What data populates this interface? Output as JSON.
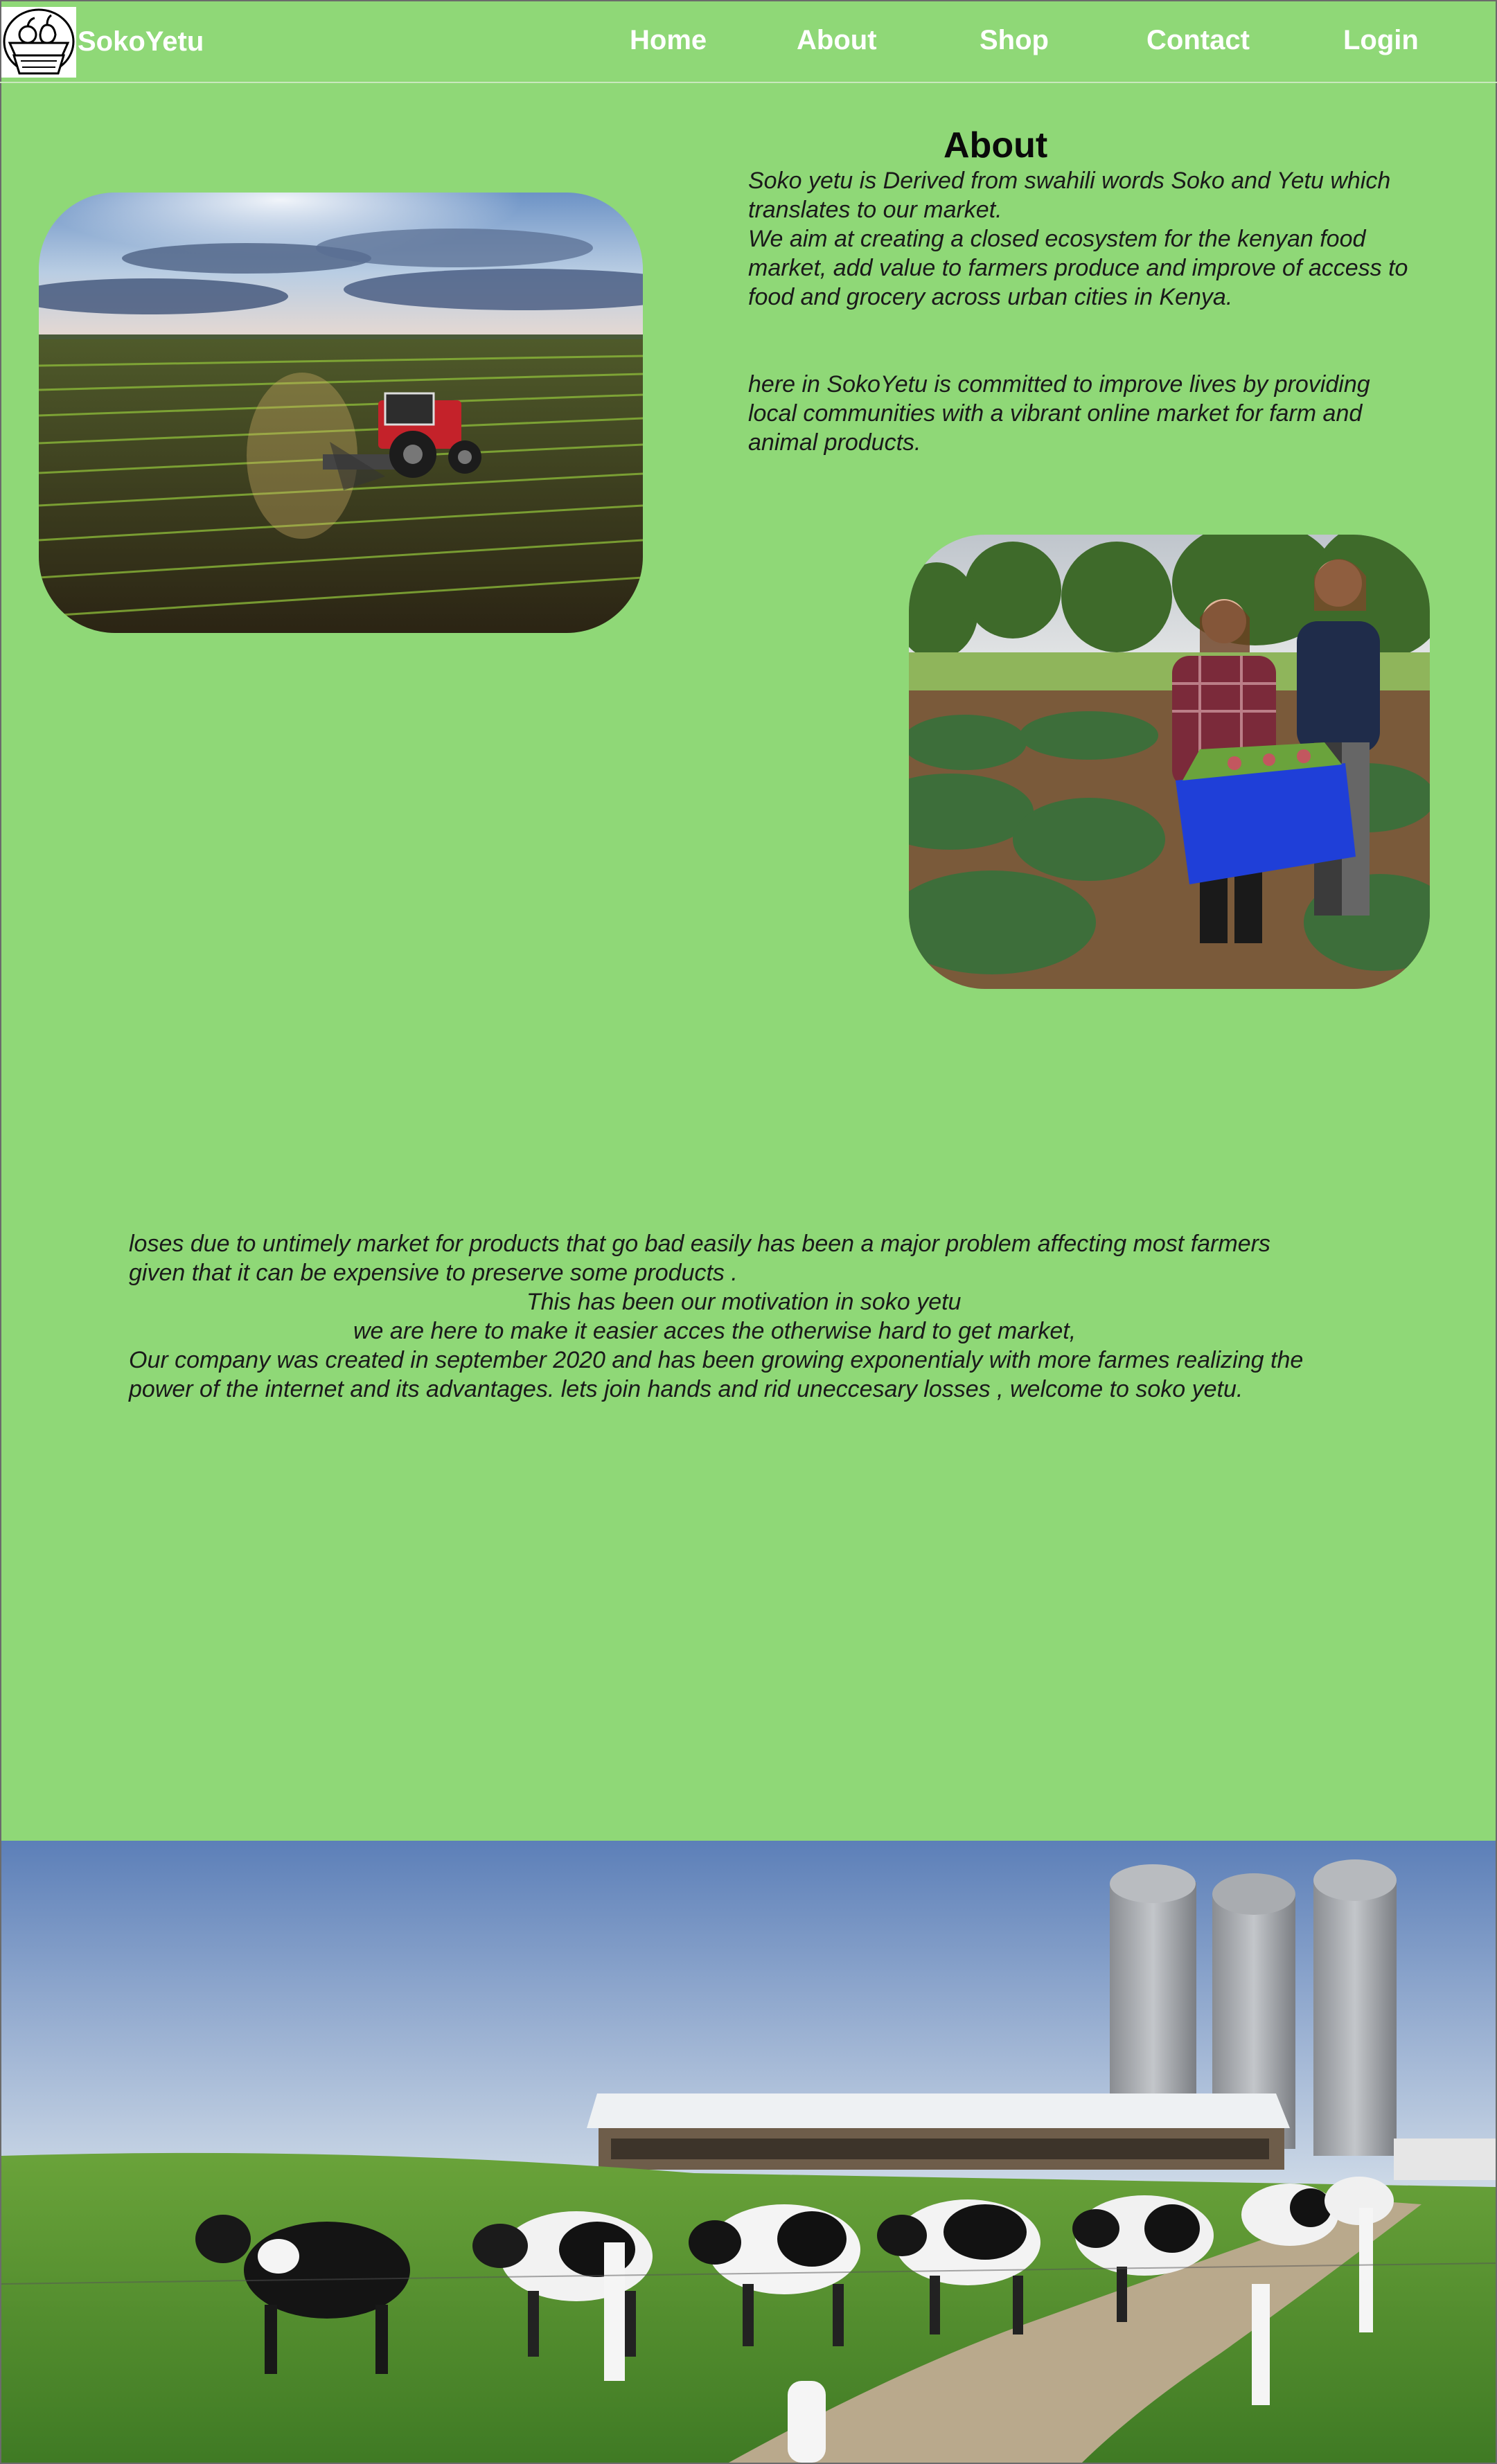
{
  "nav": {
    "brand": "SokoYetu",
    "links": [
      "Home",
      "About",
      "Shop",
      "Contact",
      "Login"
    ]
  },
  "about": {
    "title": "About",
    "para1_lines": [
      "Soko yetu is Derived from swahili words Soko and Yetu which",
      "translates to our market.",
      "We aim at creating a closed ecosystem for the kenyan food",
      "market, add value to farmers produce and improve of access to",
      "food and grocery across urban cities in Kenya."
    ],
    "para2_lines": [
      "here in SokoYetu is committed to improve lives by providing",
      "local communities with a vibrant online market for farm and",
      "animal  products."
    ]
  },
  "story": {
    "lines": [
      "loses due to untimely market for products that go bad easily has been a major problem affecting most farmers",
      "given that it can be expensive to preserve some products .",
      "This has been our motivation in soko yetu",
      "we are here to make it easier acces  the otherwise hard to get  market,",
      "Our company was created in september 2020 and has been growing exponentialy with more farmes realizing the",
      "power of the internet and its advantages. lets join hands and rid uneccesary losses , welcome to soko yetu."
    ]
  },
  "images": {
    "tractor": "tractor-field-photo",
    "farmers": "farmers-harvest-photo",
    "dairy": "dairy-farm-photo"
  },
  "colors": {
    "background": "#8fd877",
    "nav_text": "#ffffff"
  }
}
